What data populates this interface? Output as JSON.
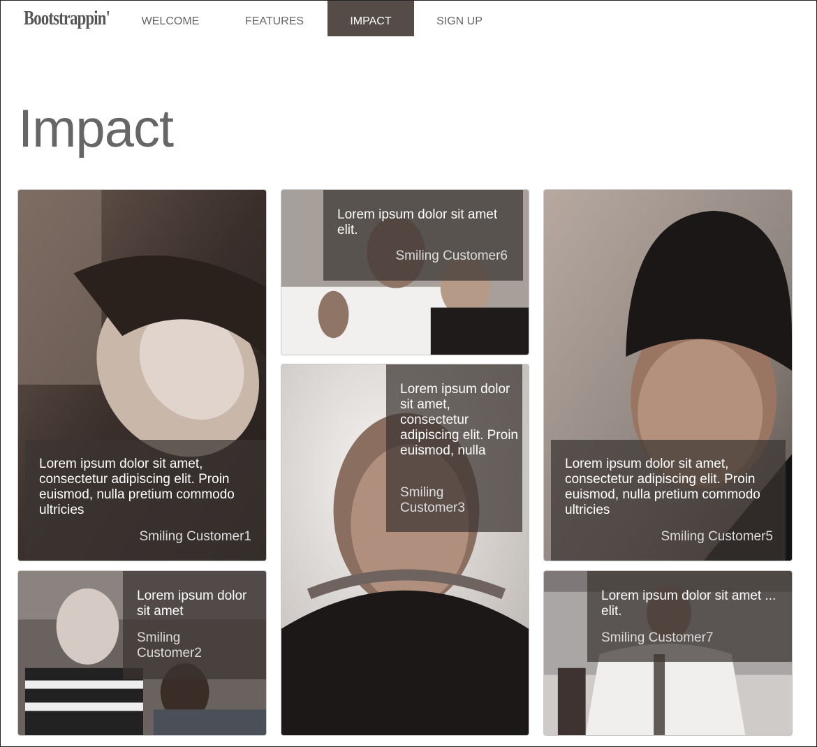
{
  "brand": "Bootstrappin'",
  "nav": [
    {
      "label": "WELCOME",
      "active": false
    },
    {
      "label": "FEATURES",
      "active": false
    },
    {
      "label": "IMPACT",
      "active": true
    },
    {
      "label": "SIGN UP",
      "active": false
    }
  ],
  "page_title": "Impact",
  "cards": [
    {
      "quote": "Lorem ipsum dolor sit amet, consectetur adipiscing elit. Proin euismod, nulla pretium commodo ultricies",
      "customer": "Smiling Customer1"
    },
    {
      "quote": "Lorem ipsum dolor sit amet",
      "customer": "Smiling Customer2"
    },
    {
      "quote": "Lorem ipsum dolor sit amet elit.",
      "customer": "Smiling Customer6"
    },
    {
      "quote": "Lorem ipsum dolor sit amet, consectetur adipiscing elit. Proin euismod, nulla",
      "customer": "Smiling Customer3"
    },
    {
      "quote": "Lorem ipsum dolor sit amet, consectetur adipiscing elit. Proin euismod, nulla pretium commodo ultricies",
      "customer": "Smiling Customer5"
    },
    {
      "quote": "Lorem ipsum dolor sit amet ... elit.",
      "customer": "Smiling Customer7"
    }
  ]
}
